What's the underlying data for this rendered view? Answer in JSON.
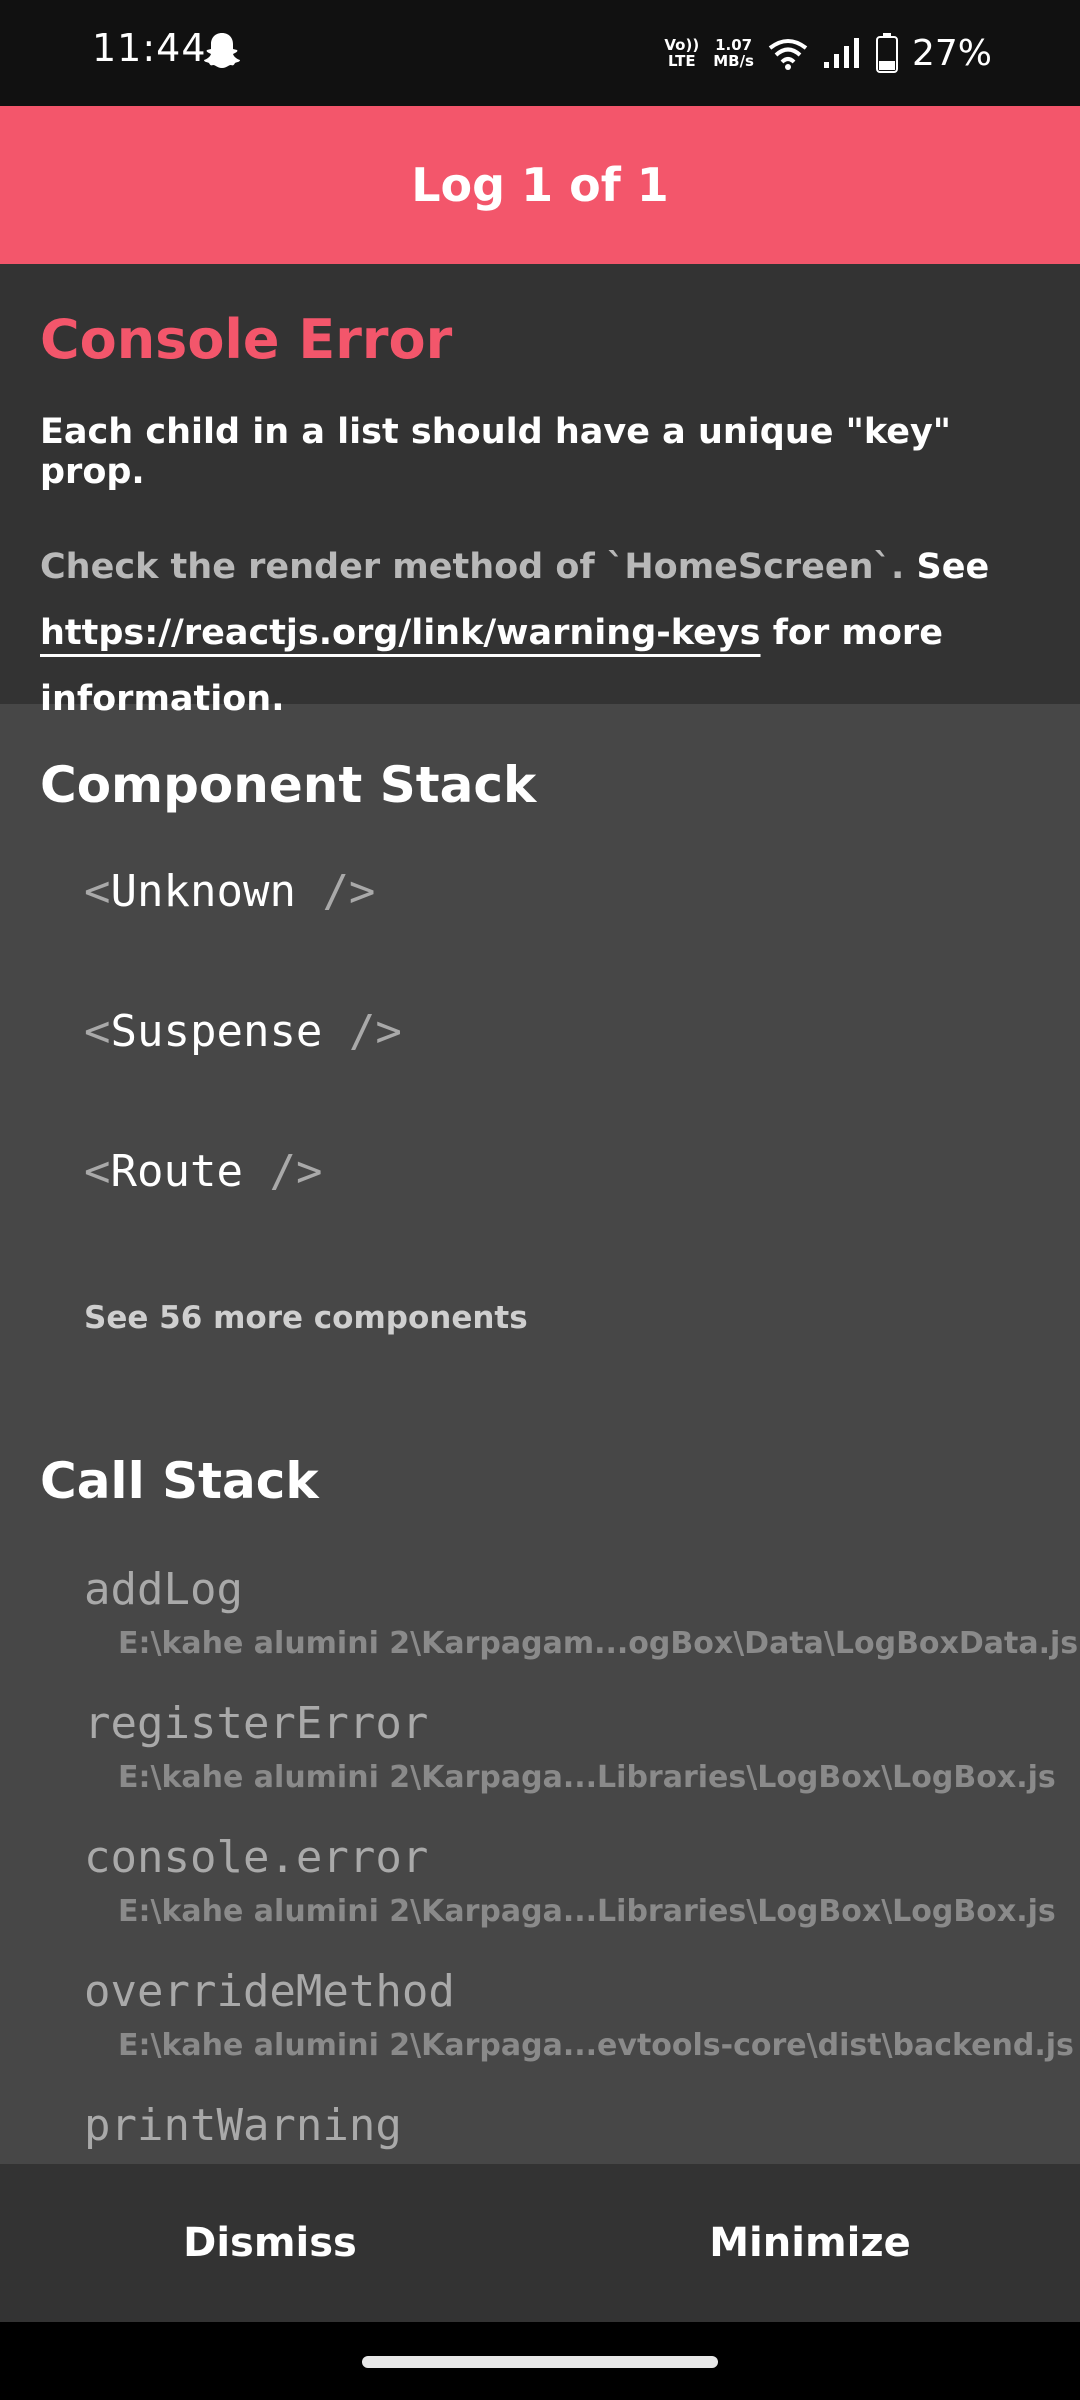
{
  "status_bar": {
    "time": "11:44",
    "network_label_top": "Vo))",
    "network_label_bottom": "LTE",
    "speed_top": "1.07",
    "speed_bottom": "MB/s",
    "battery": "27%",
    "icons": [
      "snapchat-ghost-icon",
      "wifi-icon",
      "signal-icon",
      "battery-icon"
    ]
  },
  "header": {
    "title": "Log 1 of 1"
  },
  "error": {
    "title": "Console Error",
    "message": "Each child in a list should have a unique \"key\" prop.",
    "detail_prefix": "Check the render method of `HomeScreen`.",
    "detail_see": "See",
    "detail_link": "https://reactjs.org/link/warning-keys",
    "detail_suffix": "for more information."
  },
  "component_stack": {
    "title": "Component Stack",
    "items": [
      "Unknown",
      "Suspense",
      "Route"
    ],
    "open": "<",
    "close": "/>",
    "see_more": "See 56 more components"
  },
  "call_stack": {
    "title": "Call Stack",
    "frames": [
      {
        "name": "addLog",
        "file": "E:\\kahe alumini 2\\Karpagam...ogBox\\Data\\LogBoxData.js"
      },
      {
        "name": "registerError",
        "file": "E:\\kahe alumini 2\\Karpaga...Libraries\\LogBox\\LogBox.js"
      },
      {
        "name": "console.error",
        "file": "E:\\kahe alumini 2\\Karpaga...Libraries\\LogBox\\LogBox.js"
      },
      {
        "name": "overrideMethod",
        "file": "E:\\kahe alumini 2\\Karpaga...evtools-core\\dist\\backend.js"
      },
      {
        "name": "printWarning",
        "file": ""
      }
    ]
  },
  "bottom_bar": {
    "dismiss_label": "Dismiss",
    "minimize_label": "Minimize"
  },
  "colors": {
    "accent": "#f3566b",
    "dark": "#333333",
    "panel": "#474747"
  }
}
